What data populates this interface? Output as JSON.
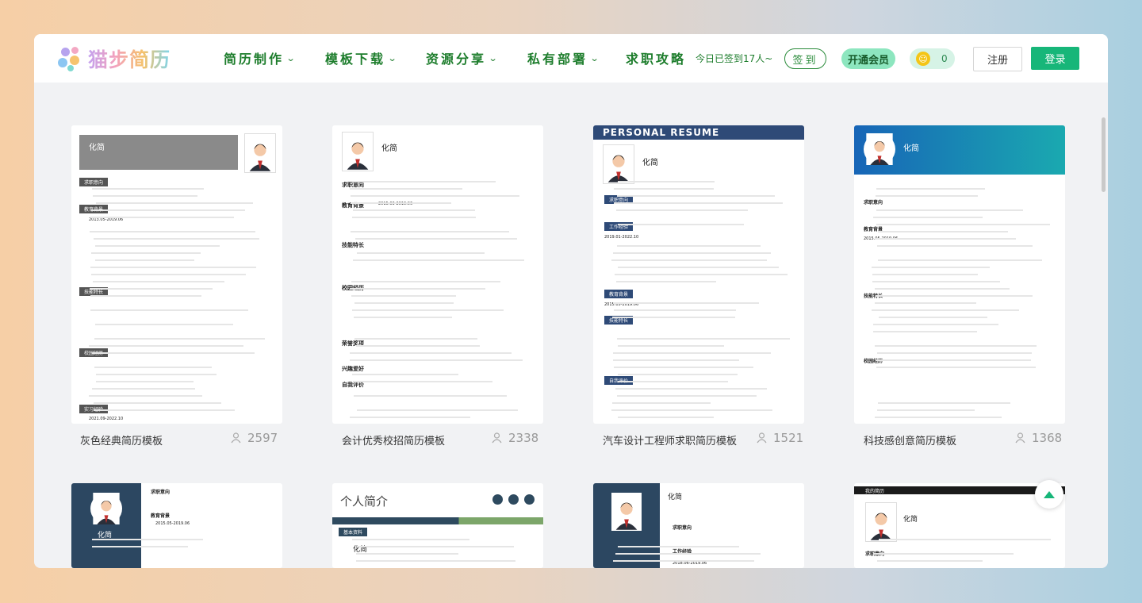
{
  "brand": {
    "name": "猫步简历"
  },
  "nav": [
    {
      "label": "简历制作",
      "has_dropdown": true
    },
    {
      "label": "模板下载",
      "has_dropdown": true
    },
    {
      "label": "资源分享",
      "has_dropdown": true
    },
    {
      "label": "私有部署",
      "has_dropdown": true
    },
    {
      "label": "求职攻略",
      "has_dropdown": false
    }
  ],
  "header": {
    "sign_count": "今日已签到17人~",
    "sign_button": "签到",
    "vip_button": "开通会员",
    "coins": "0",
    "register": "注册",
    "login": "登录"
  },
  "templates": [
    {
      "title": "灰色经典简历模板",
      "uses": "2597",
      "style": "gray"
    },
    {
      "title": "会计优秀校招简历模板",
      "uses": "2338",
      "style": "plain"
    },
    {
      "title": "汽车设计工程师求职简历模板",
      "uses": "1521",
      "style": "navy"
    },
    {
      "title": "科技感创意简历模板",
      "uses": "1368",
      "style": "tech"
    },
    {
      "title": "",
      "uses": "",
      "style": "sidebar"
    },
    {
      "title": "",
      "uses": "",
      "style": "intro"
    },
    {
      "title": "",
      "uses": "",
      "style": "blue-side"
    },
    {
      "title": "",
      "uses": "",
      "style": "black"
    }
  ],
  "resume": {
    "name": "化简",
    "personal_resume": "PERSONAL RESUME",
    "intro_heading": "个人简介",
    "sections": {
      "job": "求职意向",
      "edu": "教育背景",
      "skill": "技能特长",
      "campus": "校园经历",
      "award": "荣誉奖项",
      "hobby": "兴趣爱好",
      "self": "自我评价",
      "work": "工作经验",
      "practice": "实习经验",
      "basic": "基本资料",
      "my_info": "我的简历"
    },
    "dates": {
      "d1": "2015.03-2019.06",
      "d2": "2013.05-2019.06",
      "d3": "2015.05-2019.06",
      "d4": "2019.01-2022.10",
      "d5": "2018.06-2019.06",
      "d6": "2021.09-2022.10"
    }
  }
}
